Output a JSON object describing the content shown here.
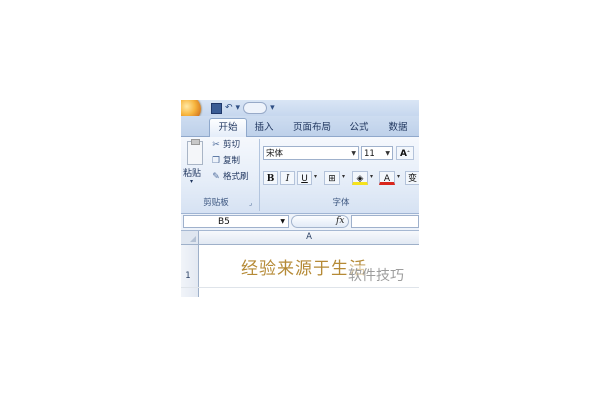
{
  "tabs": [
    "开始",
    "插入",
    "页面布局",
    "公式",
    "数据"
  ],
  "clipboard": {
    "paste_label": "粘贴",
    "cut_label": "剪切",
    "copy_label": "复制",
    "format_painter_label": "格式刷",
    "group_label": "剪贴板"
  },
  "font": {
    "name": "宋体",
    "size": "11",
    "grow_label": "A",
    "bold_label": "B",
    "italic_label": "I",
    "underline_label": "U",
    "font_color_label": "A",
    "wrap_label": "变",
    "group_label": "字体"
  },
  "formula_bar": {
    "name_box": "B5",
    "fx_label": "fx"
  },
  "sheet": {
    "column_header": "A",
    "row_number": "1",
    "cell_text": "经验来源于生活"
  },
  "watermark": "软件技巧",
  "colors": {
    "ribbon_blue": "#d6e2f3",
    "cell_text": "#b58a36"
  }
}
